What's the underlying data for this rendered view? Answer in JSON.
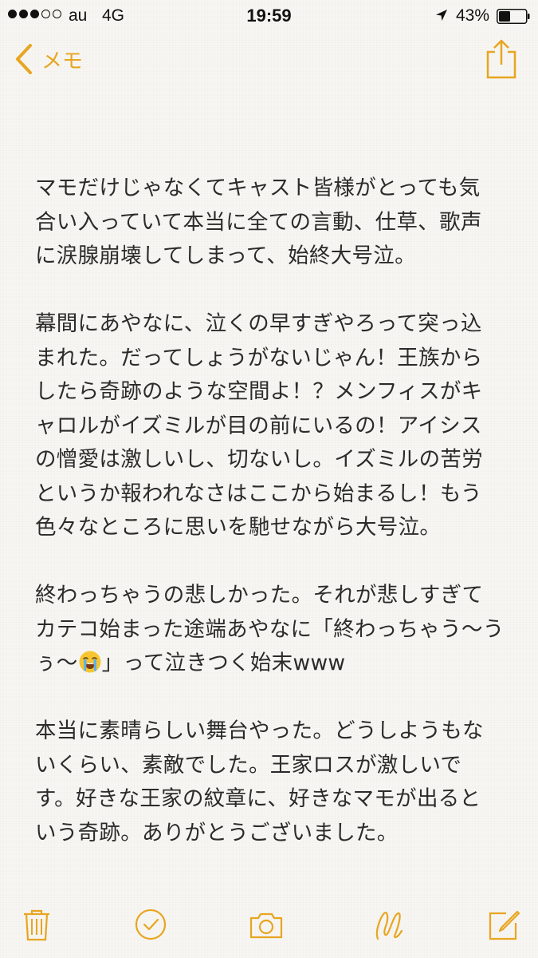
{
  "status_bar": {
    "carrier": "au",
    "network": "4G",
    "time": "19:59",
    "battery_percent": "43%",
    "signal_bars_filled": 3,
    "signal_bars_total": 5,
    "battery_level": 0.43
  },
  "nav": {
    "back_label": "メモ",
    "accent_color": "#e8a521"
  },
  "note": {
    "paragraphs": [
      "マモだけじゃなくてキャスト皆様がとっても気\n合い入っていて本当に全ての言動、仕草、歌声\nに涙腺崩壊してしまって、始終大号泣。",
      "幕間にあやなに、泣くの早すぎやろって突っ込\nまれた。だってしょうがないじゃん！王族から\nしたら奇跡のような空間よ！？メンフィスがキ\nャロルがイズミルが目の前にいるの！アイシス\nの憎愛は激しいし、切ないし。イズミルの苦労\nというか報われなさはここから始まるし！もう\n色々なところに思いを馳せながら大号泣。",
      "本当に素晴らしい舞台やった。どうしようもな\nいくらい、素敵でした。王家ロスが激しいで\nす。好きな王家の紋章に、好きなマモが出ると\nいう奇跡。ありがとうございました。"
    ],
    "p3_line1": "終わっちゃうの悲しかった。それが悲しすぎて",
    "p3_line2": "カテコ始まった途端あやなに「終わっちゃう〜う",
    "p3_line3_before": "ぅ〜",
    "p3_emoji": "loudly-crying-face-icon",
    "p3_line3_after": "」って泣きつく始末www"
  },
  "toolbar": {
    "icons": [
      "trash-icon",
      "checklist-icon",
      "camera-icon",
      "sketch-icon",
      "compose-icon"
    ]
  }
}
